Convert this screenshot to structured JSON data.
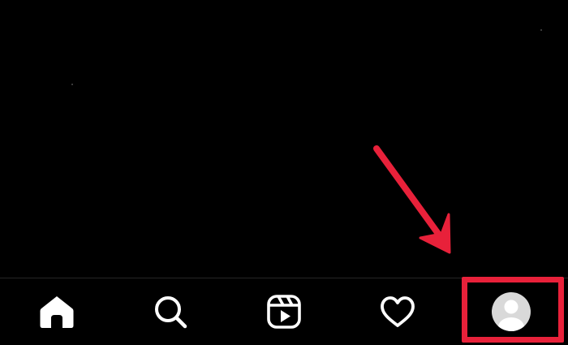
{
  "screen": {
    "background": "#000000"
  },
  "tab_bar": {
    "tabs": [
      {
        "id": "home",
        "icon": "home-icon",
        "active": true
      },
      {
        "id": "search",
        "icon": "search-icon",
        "active": false
      },
      {
        "id": "reels",
        "icon": "reels-icon",
        "active": false
      },
      {
        "id": "activity",
        "icon": "heart-icon",
        "active": false
      },
      {
        "id": "profile",
        "icon": "avatar-icon",
        "active": false
      }
    ],
    "icon_color": "#ffffff",
    "avatar_color": "#d9d9d9",
    "divider_color": "#262626"
  },
  "annotation": {
    "highlight_target": "profile",
    "color": "#e8213a"
  }
}
